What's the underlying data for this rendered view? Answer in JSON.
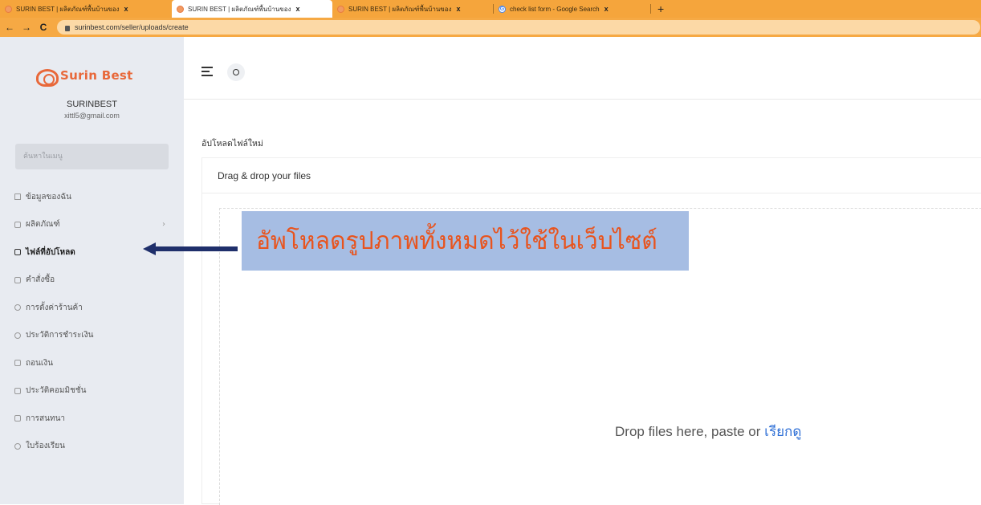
{
  "browser": {
    "tabs": [
      {
        "title": "SURIN BEST | ผลิตภัณฑ์พื้นบ้านของ",
        "active": false,
        "icon": "site-favicon"
      },
      {
        "title": "SURIN BEST | ผลิตภัณฑ์พื้นบ้านของ",
        "active": true,
        "icon": "site-favicon"
      },
      {
        "title": "SURIN BEST | ผลิตภัณฑ์พื้นบ้านของ",
        "active": false,
        "icon": "site-favicon"
      },
      {
        "title": "check list form - Google Search",
        "active": false,
        "icon": "google-icon"
      }
    ],
    "close_glyph": "x",
    "new_tab_glyph": "+",
    "url": "surinbest.com/seller/uploads/create",
    "back_glyph": "←",
    "forward_glyph": "→",
    "reload_glyph": "C"
  },
  "sidebar": {
    "logo_text": "Surin Best",
    "user_name": "SURINBEST",
    "user_email": "xittl5@gmail.com",
    "search_placeholder": "ค้นหาในเมนู",
    "items": [
      {
        "label": "ข้อมูลของฉัน",
        "icon": "home-icon",
        "active": false
      },
      {
        "label": "ผลิตภัณฑ์",
        "icon": "product-icon",
        "active": false,
        "chevron": "›"
      },
      {
        "label": "ไฟล์ที่อัปโหลด",
        "icon": "folder-icon",
        "active": true
      },
      {
        "label": "คำสั่งซื้อ",
        "icon": "order-icon",
        "active": false
      },
      {
        "label": "การตั้งค่าร้านค้า",
        "icon": "gear-icon",
        "active": false
      },
      {
        "label": "ประวัติการชำระเงิน",
        "icon": "history-icon",
        "active": false
      },
      {
        "label": "ถอนเงิน",
        "icon": "wallet-icon",
        "active": false
      },
      {
        "label": "ประวัติคอมมิชชั่น",
        "icon": "commission-icon",
        "active": false
      },
      {
        "label": "การสนทนา",
        "icon": "chat-icon",
        "active": false
      },
      {
        "label": "ใบร้องเรียน",
        "icon": "ticket-icon",
        "active": false
      }
    ]
  },
  "main": {
    "page_title": "อัปโหลดไฟล์ใหม่",
    "uploader_title": "Drag & drop your files",
    "drop_text": "Drop files here, paste or ",
    "drop_link": "เรียกดู"
  },
  "annotation": {
    "text": "อัพโหลดรูปภาพทั้งหมดไว้ใช้ในเว็บไซต์",
    "color": "#e8541e",
    "background": "#a6bde3",
    "arrow_color": "#1f2f6b"
  },
  "colors": {
    "browser_accent": "#f5a53c",
    "brand": "#e8683a",
    "link": "#2e6fd6",
    "sidebar_bg": "#e8ebf1"
  }
}
